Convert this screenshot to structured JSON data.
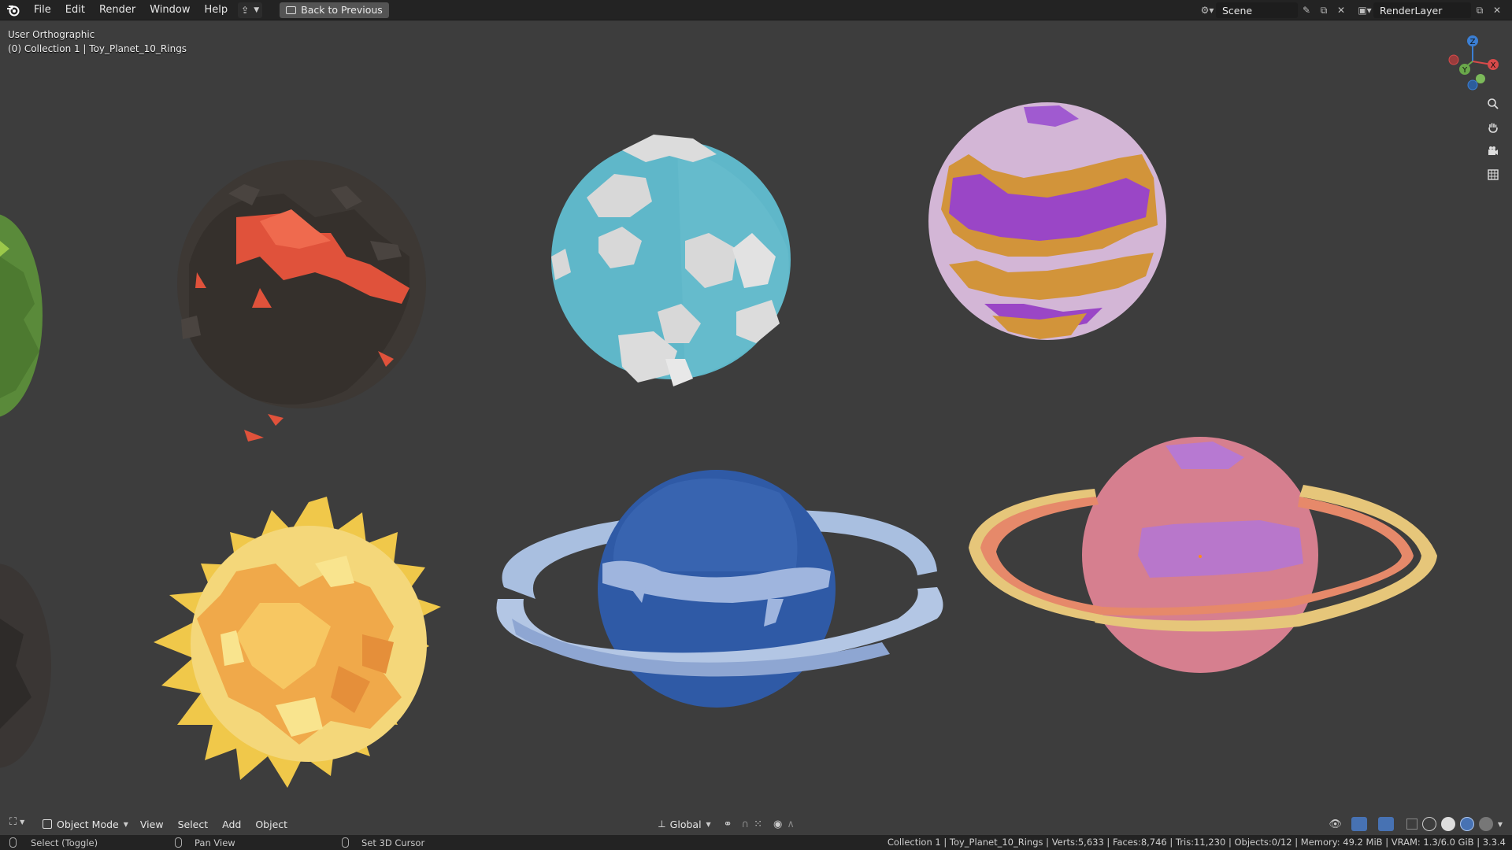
{
  "topbar": {
    "menus": [
      "File",
      "Edit",
      "Render",
      "Window",
      "Help"
    ],
    "back_label": "Back to Previous",
    "scene_name": "Scene",
    "render_layer": "RenderLayer"
  },
  "viewport": {
    "view_name": "User Orthographic",
    "collection_path": "(0) Collection 1 | Toy_Planet_10_Rings",
    "gizmo": {
      "z_label": "Z",
      "y_label": "Y",
      "x_label": "X"
    }
  },
  "header": {
    "mode": "Object Mode",
    "menus": [
      "View",
      "Select",
      "Add",
      "Object"
    ],
    "orientation": "Global"
  },
  "statusbar": {
    "hint_select": "Select (Toggle)",
    "hint_pan": "Pan View",
    "hint_cursor": "Set 3D Cursor",
    "stats": "Collection 1 | Toy_Planet_10_Rings | Verts:5,633 | Faces:8,746 | Tris:11,230 | Objects:0/12 | Memory: 49.2 MiB | VRAM: 1.3/6.0 GiB | 3.3.4"
  },
  "colors": {
    "accent": "#4772b3",
    "viewport_bg": "#3d3d3d",
    "topbar_bg": "#232323"
  }
}
